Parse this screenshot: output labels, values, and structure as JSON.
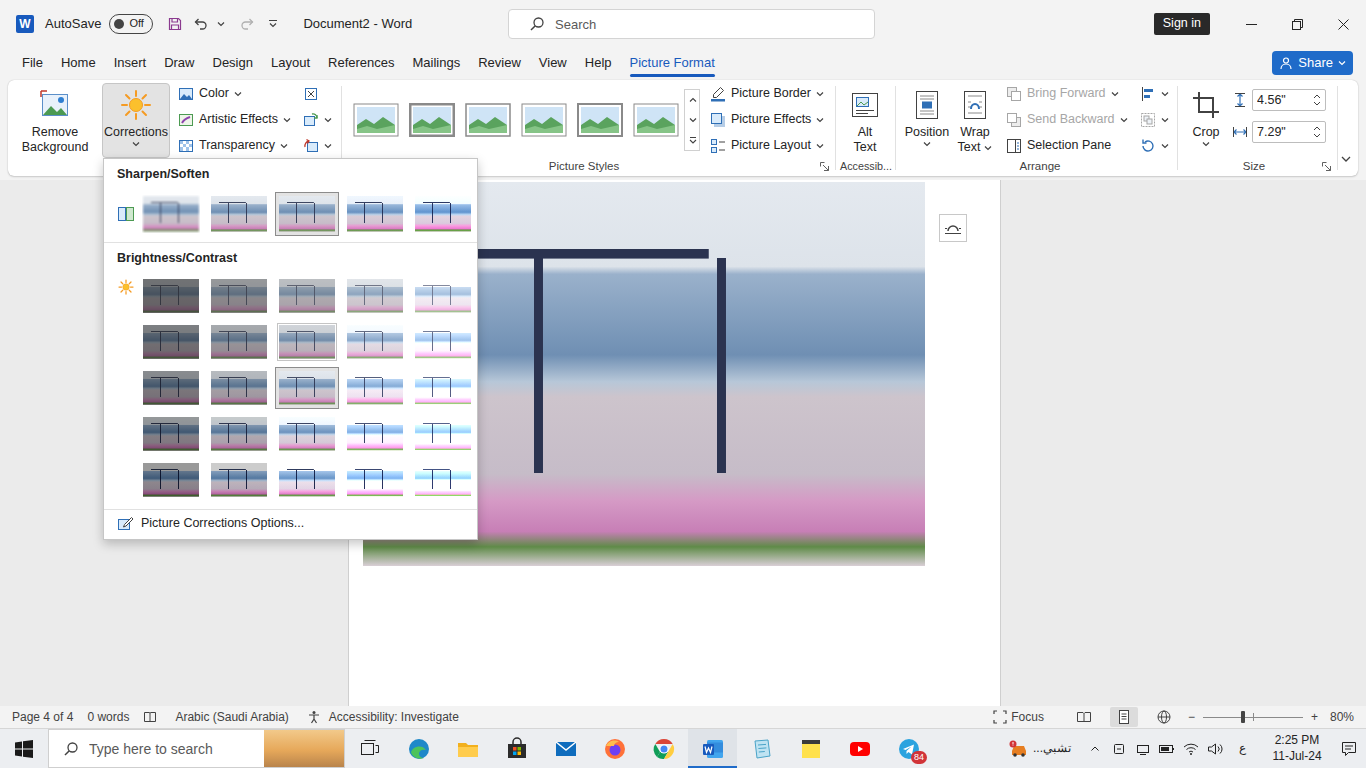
{
  "window": {
    "logo_letter": "W",
    "autosave_label": "AutoSave",
    "autosave": {
      "label": "Off",
      "on": false
    },
    "title": "Document2 - Word",
    "sign_in": "Sign in"
  },
  "search": {
    "placeholder": "Search"
  },
  "tabs": [
    {
      "label": "File",
      "selected": false
    },
    {
      "label": "Home",
      "selected": false
    },
    {
      "label": "Insert",
      "selected": false
    },
    {
      "label": "Draw",
      "selected": false
    },
    {
      "label": "Design",
      "selected": false
    },
    {
      "label": "Layout",
      "selected": false
    },
    {
      "label": "References",
      "selected": false
    },
    {
      "label": "Mailings",
      "selected": false
    },
    {
      "label": "Review",
      "selected": false
    },
    {
      "label": "View",
      "selected": false
    },
    {
      "label": "Help",
      "selected": false
    },
    {
      "label": "Picture Format",
      "selected": true
    }
  ],
  "share": "Share",
  "ribbon": {
    "remove_background": [
      "Remove",
      "Background"
    ],
    "corrections": {
      "label": "Corrections",
      "expanded": true
    },
    "adjust_items": [
      {
        "label": "Color"
      },
      {
        "label": "Artistic Effects"
      },
      {
        "label": "Transparency"
      }
    ],
    "picture_styles": {
      "label": "Picture Styles",
      "thumbnails": [
        {
          "selected": false
        },
        {
          "selected": false
        },
        {
          "selected": false
        },
        {
          "selected": false
        },
        {
          "selected": false
        },
        {
          "selected": false
        }
      ],
      "items": [
        {
          "label": "Picture Border"
        },
        {
          "label": "Picture Effects"
        },
        {
          "label": "Picture Layout"
        }
      ]
    },
    "accessibility": {
      "label": "Accessib...",
      "alt_text": [
        "Alt",
        "Text"
      ]
    },
    "arrange": {
      "label": "Arrange",
      "position": "Position",
      "wrap_text": [
        "Wrap",
        "Text"
      ],
      "items": [
        {
          "label": "Bring Forward",
          "disabled": true
        },
        {
          "label": "Send Backward",
          "disabled": true
        },
        {
          "label": "Selection Pane",
          "disabled": false
        }
      ],
      "tools": [
        {
          "disabled": false
        },
        {
          "disabled": true
        },
        {
          "disabled": false
        }
      ]
    },
    "size": {
      "label": "Size",
      "crop": "Crop",
      "height": "4.56\"",
      "width": "7.29\""
    }
  },
  "corrections_menu": {
    "sharpen_title": "Sharpen/Soften",
    "sharpen": [
      {
        "level": 0,
        "selected": false
      },
      {
        "level": 0.25,
        "selected": false
      },
      {
        "level": 0.5,
        "selected": true
      },
      {
        "level": 0.75,
        "selected": false
      },
      {
        "level": 1,
        "selected": false
      }
    ],
    "brightness_title": "Brightness/Contrast",
    "brightness": [
      [
        {
          "brightness": 0,
          "contrast": 0,
          "selected": false,
          "hover": false
        },
        {
          "brightness": 0.25,
          "contrast": 0,
          "selected": false,
          "hover": false
        },
        {
          "brightness": 0.5,
          "contrast": 0,
          "selected": false,
          "hover": false
        },
        {
          "brightness": 0.75,
          "contrast": 0,
          "selected": false,
          "hover": false
        },
        {
          "brightness": 1,
          "contrast": 0,
          "selected": false,
          "hover": false
        }
      ],
      [
        {
          "brightness": 0,
          "contrast": 0.25,
          "selected": false,
          "hover": false
        },
        {
          "brightness": 0.25,
          "contrast": 0.25,
          "selected": false,
          "hover": false
        },
        {
          "brightness": 0.5,
          "contrast": 0.25,
          "selected": false,
          "hover": true
        },
        {
          "brightness": 0.75,
          "contrast": 0.25,
          "selected": false,
          "hover": false
        },
        {
          "brightness": 1,
          "contrast": 0.25,
          "selected": false,
          "hover": false
        }
      ],
      [
        {
          "brightness": 0,
          "contrast": 0.5,
          "selected": false,
          "hover": false
        },
        {
          "brightness": 0.25,
          "contrast": 0.5,
          "selected": false,
          "hover": false
        },
        {
          "brightness": 0.5,
          "contrast": 0.5,
          "selected": true,
          "hover": false
        },
        {
          "brightness": 0.75,
          "contrast": 0.5,
          "selected": false,
          "hover": false
        },
        {
          "brightness": 1,
          "contrast": 0.5,
          "selected": false,
          "hover": false
        }
      ],
      [
        {
          "brightness": 0,
          "contrast": 0.75,
          "selected": false,
          "hover": false
        },
        {
          "brightness": 0.25,
          "contrast": 0.75,
          "selected": false,
          "hover": false
        },
        {
          "brightness": 0.5,
          "contrast": 0.75,
          "selected": false,
          "hover": false
        },
        {
          "brightness": 0.75,
          "contrast": 0.75,
          "selected": false,
          "hover": false
        },
        {
          "brightness": 1,
          "contrast": 0.75,
          "selected": false,
          "hover": false
        }
      ],
      [
        {
          "brightness": 0,
          "contrast": 1,
          "selected": false,
          "hover": false
        },
        {
          "brightness": 0.25,
          "contrast": 1,
          "selected": false,
          "hover": false
        },
        {
          "brightness": 0.5,
          "contrast": 1,
          "selected": false,
          "hover": false
        },
        {
          "brightness": 0.75,
          "contrast": 1,
          "selected": false,
          "hover": false
        },
        {
          "brightness": 1,
          "contrast": 1,
          "selected": false,
          "hover": false
        }
      ]
    ],
    "options": "Picture Corrections Options..."
  },
  "status_bar": {
    "page": "Page 4 of 4",
    "words": "0 words",
    "language": "Arabic (Saudi Arabia)",
    "accessibility": "Accessibility: Investigate",
    "focus": "Focus",
    "views": [
      {
        "selected": false
      },
      {
        "selected": true
      },
      {
        "selected": false
      }
    ],
    "zoom_out": "−",
    "zoom_in": "+",
    "zoom": {
      "level": 0.4,
      "reading": "80%"
    }
  },
  "taskbar": {
    "search_placeholder": "Type here to search",
    "apps": [
      {
        "kind": "edge",
        "active": false
      },
      {
        "kind": "explorer",
        "active": false
      },
      {
        "kind": "store",
        "active": false
      },
      {
        "kind": "mail",
        "active": false
      },
      {
        "kind": "firefox",
        "active": false
      },
      {
        "kind": "chrome",
        "active": false
      },
      {
        "kind": "word",
        "active": true
      },
      {
        "kind": "notes",
        "active": false
      },
      {
        "kind": "sticky",
        "active": false
      },
      {
        "kind": "youtube",
        "active": false
      },
      {
        "kind": "telegram",
        "active": false,
        "badge": "84"
      }
    ],
    "news": "تشبي...",
    "language": "ع",
    "time": "2:25 PM",
    "date": "11-Jul-24"
  }
}
